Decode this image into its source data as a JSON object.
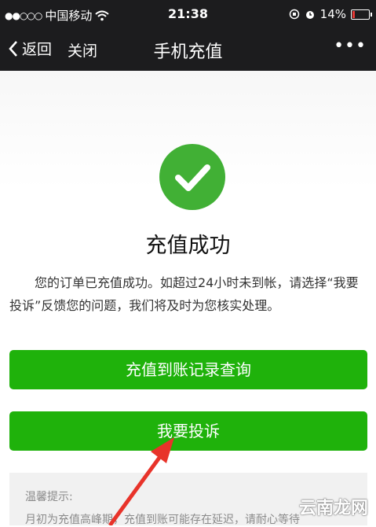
{
  "status_bar": {
    "carrier": "中国移动",
    "time": "21:38",
    "battery_percent": "14%",
    "battery_level": 0.14,
    "battery_color": "#e53935"
  },
  "nav": {
    "back_label": "返回",
    "close_label": "关闭",
    "title": "手机充值",
    "more_icon": "more-icon"
  },
  "result": {
    "icon": "check-circle-icon",
    "icon_color": "#41b035",
    "title": "充值成功",
    "message": "您的订单已充值成功。如超过24小时未到帐，请选择“我要投诉”反馈您的问题，我们将及时为您核实处理。"
  },
  "buttons": {
    "query_label": "充值到账记录查询",
    "complain_label": "我要投诉",
    "color": "#1fb20b"
  },
  "tips": {
    "title": "温馨提示:",
    "text": "月初为充值高峰期，充值到账可能存在延迟，请耐心等待"
  },
  "watermark": "云南龙网"
}
